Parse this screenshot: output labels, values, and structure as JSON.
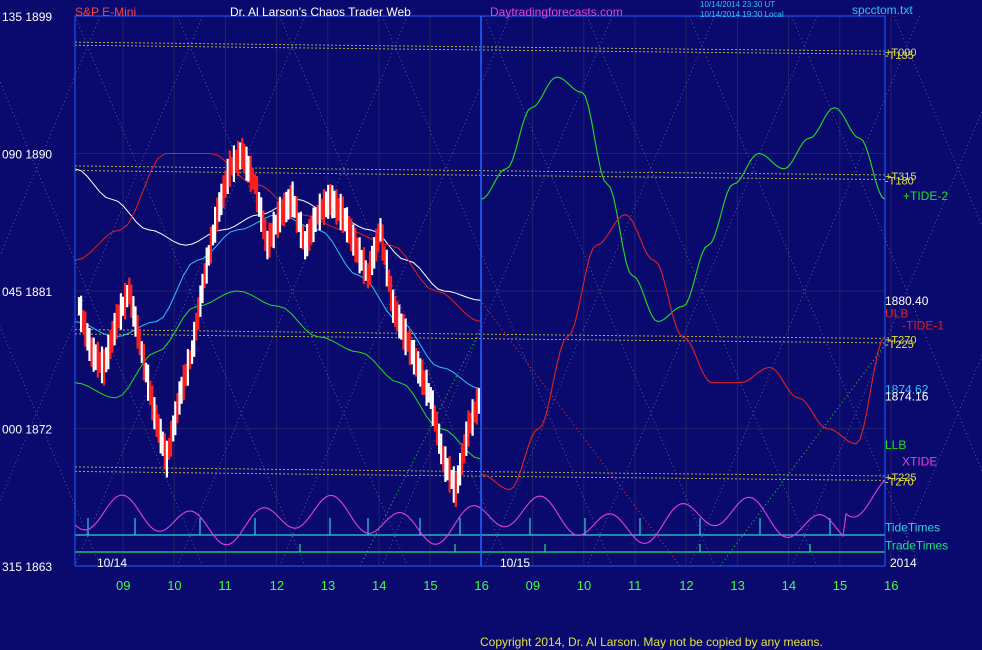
{
  "header": {
    "symbol": "S&P E-Mini",
    "title": "Dr. Al Larson's Chaos Trader Web",
    "site": "Daytradingforecasts.com",
    "stamp_line1": "10/14/2014 23:30 UT",
    "stamp_line2": "10/14/2014 19:30 Local",
    "chart_file": "spcctom.txt"
  },
  "footer": {
    "copyright": "Copyright 2014, Dr. Al Larson. May not be copied by any means."
  },
  "colors": {
    "background": "#0a0a6e",
    "price_up": "#ffffff",
    "price_down": "#ff2020",
    "tide_plus": "#20e020",
    "tide_minus": "#e02020",
    "xtide": "#e040e0",
    "tidetimes": "#30d0e0",
    "tradetimes": "#20e080",
    "moving_avg": "#30c0ff",
    "levels": "#e0e040",
    "title_red": "#ff4040",
    "title_magenta": "#e040e0",
    "text_white": "#ffffff",
    "axis_green": "#40ff40",
    "frame_blue": "#2060ff"
  },
  "chart_data": {
    "type": "line",
    "ylim": [
      1863,
      1899
    ],
    "y_ticks": [
      {
        "value": 1899,
        "label": "135  1899"
      },
      {
        "value": 1890,
        "label": "090  1890"
      },
      {
        "value": 1881,
        "label": "045  1881"
      },
      {
        "value": 1872,
        "label": "000  1872"
      },
      {
        "value": 1863,
        "label": "315  1863"
      }
    ],
    "x_ticks": [
      "09",
      "10",
      "11",
      "12",
      "13",
      "14",
      "15",
      "16",
      "09",
      "10",
      "11",
      "12",
      "13",
      "14",
      "15",
      "16"
    ],
    "date_labels": [
      "10/14",
      "10/15",
      "2014"
    ],
    "right_labels": [
      {
        "text": "+T000",
        "value": 1896.7,
        "color": "#e0e040"
      },
      {
        "text": "-T135",
        "value": 1896.5,
        "color": "#e0e040"
      },
      {
        "text": "+T315",
        "value": 1888.6,
        "color": "#e0e040"
      },
      {
        "text": "-T180",
        "value": 1888.3,
        "color": "#e0e040"
      },
      {
        "text": "+TIDE-2",
        "value": 1887.3,
        "color": "#20e020"
      },
      {
        "text": "1880.40",
        "value": 1880.4,
        "color": "#ffffff"
      },
      {
        "text": "ULB",
        "value": 1879.6,
        "color": "#e02020"
      },
      {
        "text": "-TIDE-1",
        "value": 1878.8,
        "color": "#e02020"
      },
      {
        "text": "+T270",
        "value": 1877.9,
        "color": "#e0e040"
      },
      {
        "text": "-T225",
        "value": 1877.6,
        "color": "#e0e040"
      },
      {
        "text": "1874.62",
        "value": 1874.62,
        "color": "#30c0ff"
      },
      {
        "text": "1874.16",
        "value": 1874.16,
        "color": "#ffffff"
      },
      {
        "text": "LLB",
        "value": 1871.0,
        "color": "#20e020"
      },
      {
        "text": "XTIDE",
        "value": 1869.9,
        "color": "#e040e0"
      },
      {
        "text": "+T225",
        "value": 1868.9,
        "color": "#e0e040"
      },
      {
        "text": "-T270",
        "value": 1868.6,
        "color": "#e0e040"
      },
      {
        "text": "TideTimes",
        "value": 1865.6,
        "color": "#30d0e0"
      },
      {
        "text": "TradeTimes",
        "value": 1864.4,
        "color": "#20e080"
      }
    ],
    "price_close": [
      1880,
      1877,
      1876,
      1879,
      1881,
      1877,
      1873,
      1870,
      1874,
      1877,
      1882,
      1886,
      1889,
      1890,
      1888,
      1884,
      1886,
      1887,
      1884,
      1886,
      1887,
      1886,
      1884,
      1882,
      1885,
      1880,
      1878,
      1876,
      1874,
      1870,
      1868,
      1872,
      1874.16
    ],
    "tide_plus": [
      1887,
      1889,
      1893,
      1895,
      1894,
      1888,
      1882,
      1879,
      1880,
      1884,
      1888,
      1890,
      1889,
      1891,
      1893,
      1891,
      1887
    ],
    "tide_minus": [
      1869,
      1868,
      1872,
      1878,
      1884,
      1886,
      1883,
      1878,
      1875,
      1875,
      1876,
      1874,
      1872,
      1871,
      1878
    ],
    "moving_averages": [
      {
        "color": "#ffffff",
        "values": [
          1889,
          1887,
          1885,
          1884,
          1885,
          1886,
          1887,
          1886,
          1885,
          1883,
          1881,
          1880.4
        ]
      },
      {
        "color": "#30c0ff",
        "values": [
          1879,
          1878,
          1879,
          1883,
          1885,
          1886,
          1885,
          1882,
          1879,
          1876,
          1874.6
        ]
      },
      {
        "color": "#20e020",
        "values": [
          1875,
          1874,
          1877,
          1880,
          1881,
          1880,
          1878,
          1877,
          1875,
          1872,
          1870
        ]
      },
      {
        "color": "#e02020",
        "values": [
          1883,
          1885,
          1890,
          1890,
          1888,
          1886,
          1885,
          1884,
          1881,
          1879
        ]
      }
    ]
  }
}
